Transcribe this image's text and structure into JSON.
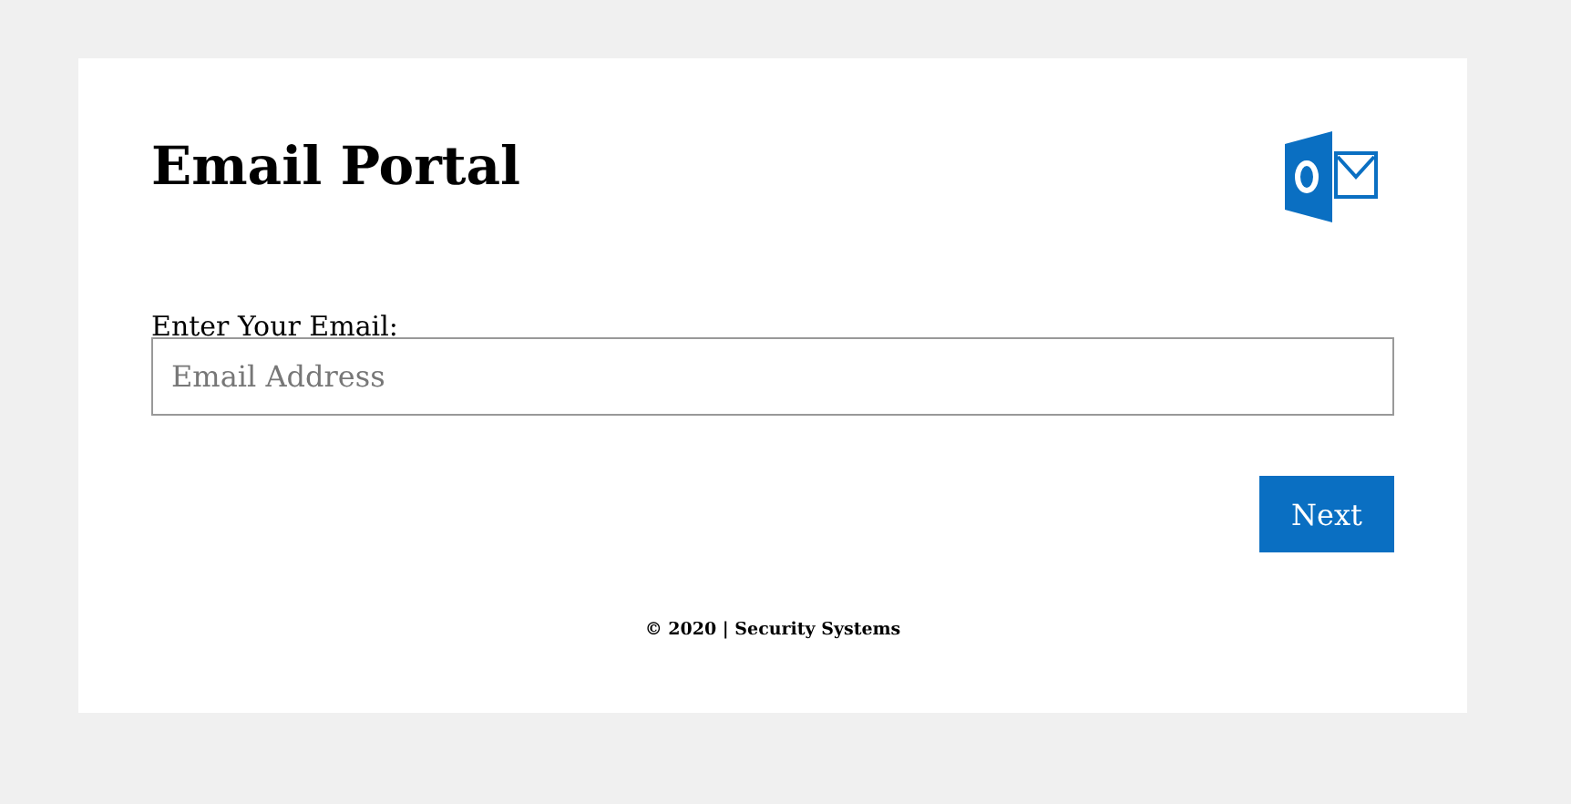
{
  "title": "Email Portal",
  "email_field": {
    "label": "Enter Your Email:",
    "placeholder": "Email Address"
  },
  "next_button": "Next",
  "footer": "© 2020 | Security Systems"
}
